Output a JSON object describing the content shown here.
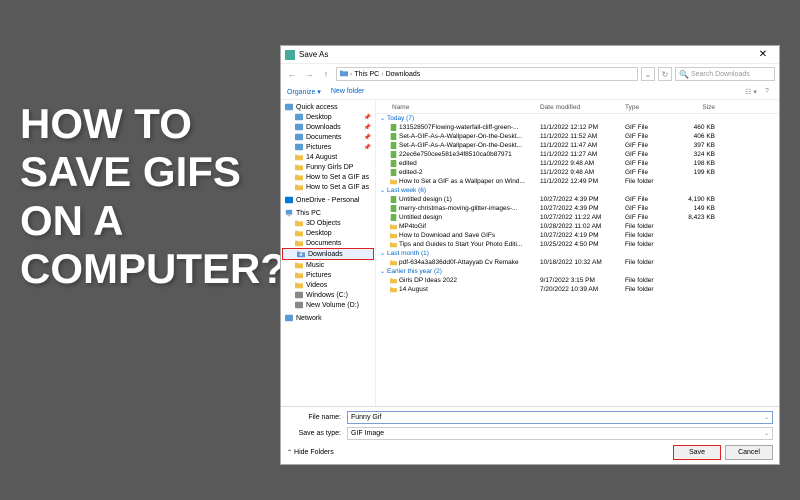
{
  "heading": "HOW TO SAVE GIFS ON A COMPUTER?",
  "dialog": {
    "title": "Save As",
    "breadcrumb": [
      "This PC",
      "Downloads"
    ],
    "search_placeholder": "Search Downloads",
    "organize": "Organize",
    "new_folder": "New folder",
    "hide_folders": "Hide Folders",
    "filename_label": "File name:",
    "filename": "Funny Gif",
    "saveastype_label": "Save as type:",
    "saveastype": "GIF Image",
    "save": "Save",
    "cancel": "Cancel"
  },
  "headers": {
    "name": "Name",
    "date": "Date modified",
    "type": "Type",
    "size": "Size"
  },
  "tree": {
    "quick": "Quick access",
    "items1": [
      "Desktop",
      "Downloads",
      "Documents",
      "Pictures",
      "14 August",
      "Funny Girls DP",
      "How to Set a GIF as",
      "How to Set a GIF as"
    ],
    "onedrive": "OneDrive - Personal",
    "thispc": "This PC",
    "items2": [
      "3D Objects",
      "Desktop",
      "Documents",
      "Downloads",
      "Music",
      "Pictures",
      "Videos",
      "Windows (C:)",
      "New Volume (D:)"
    ],
    "network": "Network"
  },
  "groups": [
    {
      "label": "Today (7)",
      "files": [
        {
          "n": "131528507Flowing-waterfall-cliff-green-...",
          "d": "11/1/2022 12:12 PM",
          "t": "GIF File",
          "s": "460 KB",
          "c": "#6bb34f"
        },
        {
          "n": "Set-A-GIF-As-A-Wallpaper-On-the-Deskt...",
          "d": "11/1/2022 11:52 AM",
          "t": "GIF File",
          "s": "406 KB",
          "c": "#6bb34f"
        },
        {
          "n": "Set-A-GIF-As-A-Wallpaper-On-the-Deskt...",
          "d": "11/1/2022 11:47 AM",
          "t": "GIF File",
          "s": "397 KB",
          "c": "#6bb34f"
        },
        {
          "n": "22ec6e750cee581e34f8510ca0b87971",
          "d": "11/1/2022 11:27 AM",
          "t": "GIF File",
          "s": "324 KB",
          "c": "#6bb34f"
        },
        {
          "n": "edited",
          "d": "11/1/2022 9:48 AM",
          "t": "GIF File",
          "s": "198 KB",
          "c": "#6bb34f"
        },
        {
          "n": "edited-2",
          "d": "11/1/2022 9:48 AM",
          "t": "GIF File",
          "s": "199 KB",
          "c": "#6bb34f"
        },
        {
          "n": "How to Set a GIF as a Wallpaper on Wind...",
          "d": "11/1/2022 12:49 PM",
          "t": "File folder",
          "s": "",
          "c": "#f0c04a"
        }
      ]
    },
    {
      "label": "Last week (6)",
      "files": [
        {
          "n": "Untitled design (1)",
          "d": "10/27/2022 4:39 PM",
          "t": "GIF File",
          "s": "4,190 KB",
          "c": "#6bb34f"
        },
        {
          "n": "merry-christmas-moving-glitter-images-...",
          "d": "10/27/2022 4:39 PM",
          "t": "GIF File",
          "s": "149 KB",
          "c": "#6bb34f"
        },
        {
          "n": "Untitled design",
          "d": "10/27/2022 11:22 AM",
          "t": "GIF File",
          "s": "8,423 KB",
          "c": "#6bb34f"
        },
        {
          "n": "MP4toGif",
          "d": "10/28/2022 11:02 AM",
          "t": "File folder",
          "s": "",
          "c": "#f0c04a"
        },
        {
          "n": "How to Download and Save GIFs",
          "d": "10/27/2022 4:19 PM",
          "t": "File folder",
          "s": "",
          "c": "#f0c04a"
        },
        {
          "n": "Tips and Guides to Start Your Photo Editi...",
          "d": "10/25/2022 4:50 PM",
          "t": "File folder",
          "s": "",
          "c": "#f0c04a"
        }
      ]
    },
    {
      "label": "Last month (1)",
      "files": [
        {
          "n": "pdf-634a3a836dd0f-Attayyab Cv Remake",
          "d": "10/18/2022 10:32 AM",
          "t": "File folder",
          "s": "",
          "c": "#f0c04a"
        }
      ]
    },
    {
      "label": "Earlier this year (2)",
      "files": [
        {
          "n": "Girls DP Ideas 2022",
          "d": "9/17/2022 3:15 PM",
          "t": "File folder",
          "s": "",
          "c": "#f0c04a"
        },
        {
          "n": "14 August",
          "d": "7/20/2022 10:39 AM",
          "t": "File folder",
          "s": "",
          "c": "#f0c04a"
        }
      ]
    }
  ]
}
